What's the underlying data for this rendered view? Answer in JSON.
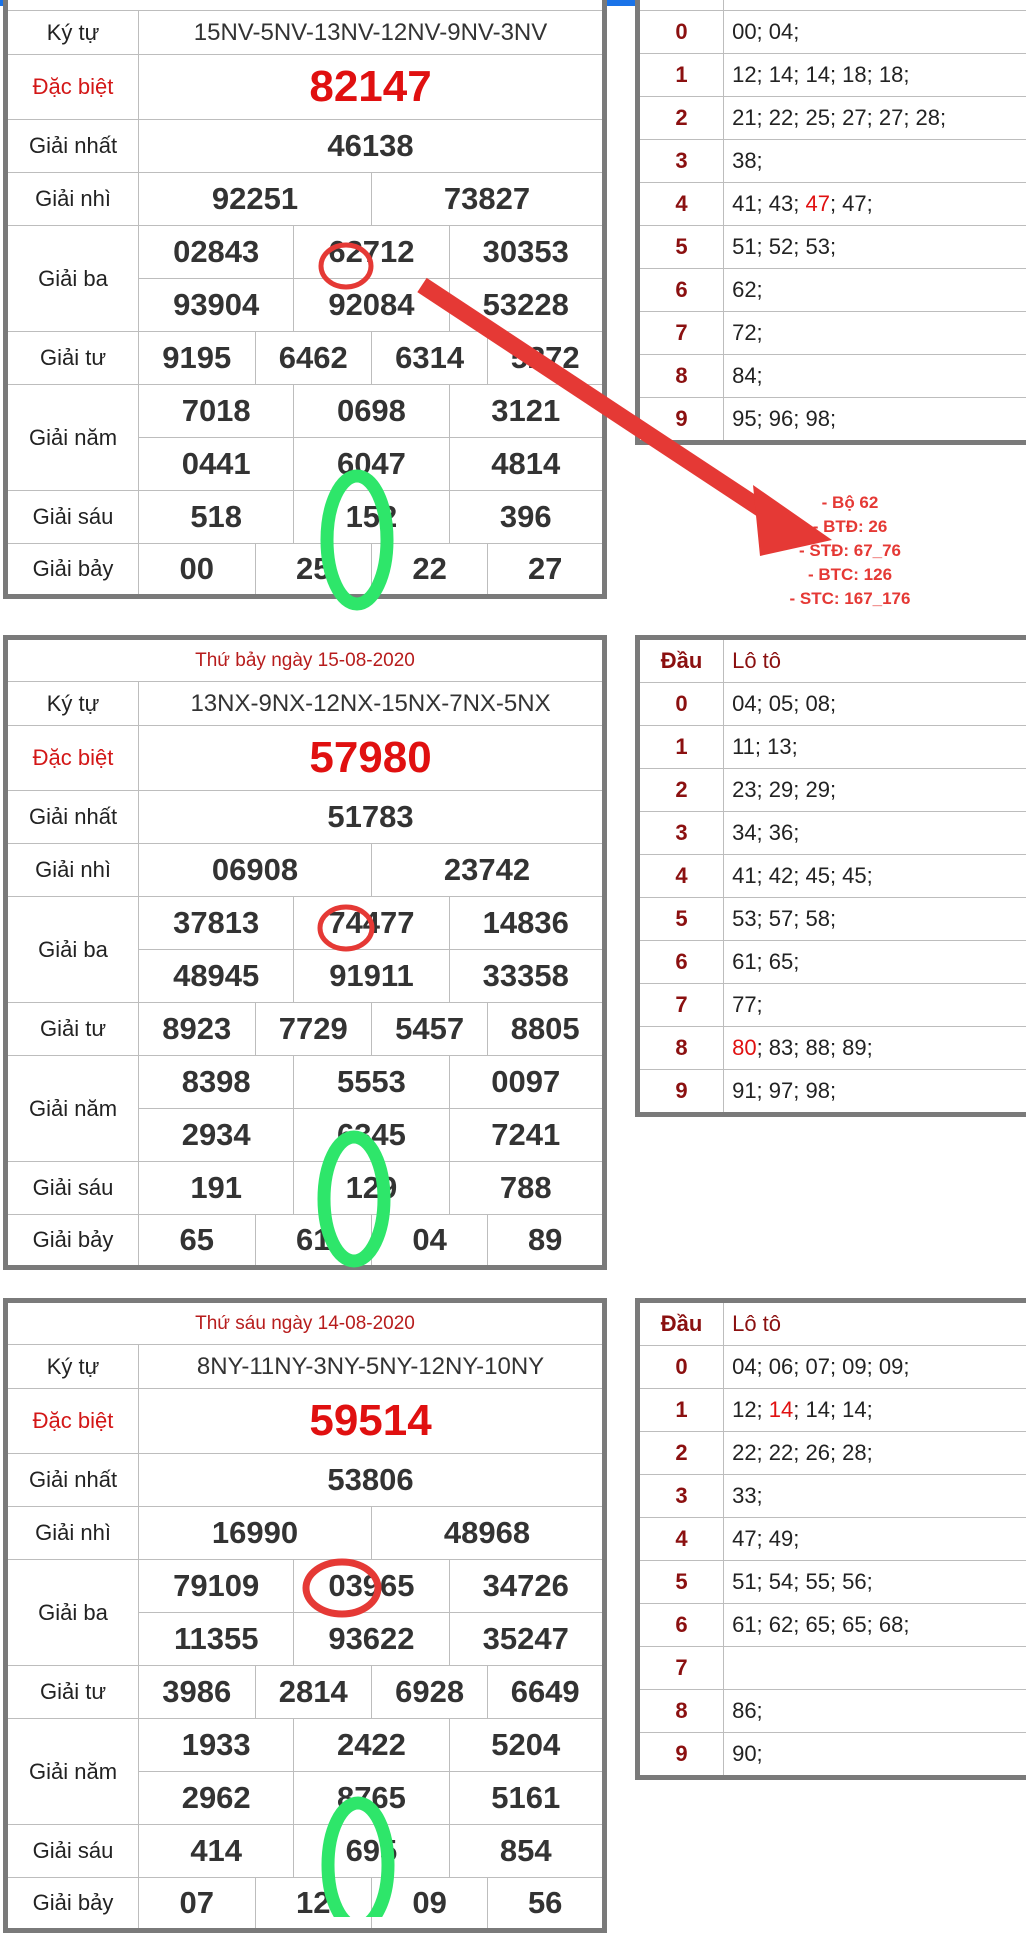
{
  "progress": {
    "fraction": 0.84
  },
  "colors": {
    "special": "#e01010",
    "highlight": "#e01010",
    "label_red": "#d31717",
    "circle_red": "#e53935",
    "circle_green": "#2ee66a",
    "frame": "#7a7a7a"
  },
  "labels": {
    "ky_tu": "Ký tự",
    "dac_biet": "Đặc biệt",
    "giai_nhat": "Giải nhất",
    "giai_nhi": "Giải nhì",
    "giai_ba": "Giải ba",
    "giai_tu": "Giải tư",
    "giai_nam": "Giải năm",
    "giai_sau": "Giải sáu",
    "giai_bay": "Giải bảy",
    "dau": "Đầu",
    "loto": "Lô tô"
  },
  "annotation": {
    "lines": [
      "- Bộ 62",
      "- BTĐ: 26",
      "- STĐ: 67_76",
      "- BTC: 126",
      "- STC: 167_176"
    ]
  },
  "draws": [
    {
      "date": "",
      "code": "15NV-5NV-13NV-12NV-9NV-3NV",
      "special": "82147",
      "first": "46138",
      "second": [
        "92251",
        "73827"
      ],
      "third": [
        [
          "02843",
          "62712",
          "30353"
        ],
        [
          "93904",
          "92084",
          "53228"
        ]
      ],
      "fourth": [
        "9195",
        "6462",
        "6314",
        "5272"
      ],
      "fifth": [
        [
          "7018",
          "0698",
          "3121"
        ],
        [
          "0441",
          "6047",
          "4814"
        ]
      ],
      "sixth": [
        "518",
        "152",
        "396"
      ],
      "seventh": [
        "00",
        "25",
        "22",
        "27"
      ],
      "loto": [
        {
          "d": "0",
          "v": [
            {
              "t": "00; 04;"
            }
          ]
        },
        {
          "d": "1",
          "v": [
            {
              "t": "12; 14; 14; 18; 18;"
            }
          ]
        },
        {
          "d": "2",
          "v": [
            {
              "t": "21; 22; 25; 27; 27; 28;"
            }
          ]
        },
        {
          "d": "3",
          "v": [
            {
              "t": "38;"
            }
          ]
        },
        {
          "d": "4",
          "v": [
            {
              "t": "41; 43; "
            },
            {
              "t": "47",
              "hl": true
            },
            {
              "t": "; 47;"
            }
          ]
        },
        {
          "d": "5",
          "v": [
            {
              "t": "51; 52; 53;"
            }
          ]
        },
        {
          "d": "6",
          "v": [
            {
              "t": "62;"
            }
          ]
        },
        {
          "d": "7",
          "v": [
            {
              "t": "72;"
            }
          ]
        },
        {
          "d": "8",
          "v": [
            {
              "t": "84;"
            }
          ]
        },
        {
          "d": "9",
          "v": [
            {
              "t": "95; 96; 98;"
            }
          ]
        }
      ]
    },
    {
      "date": "Thứ bảy ngày 15-08-2020",
      "code": "13NX-9NX-12NX-15NX-7NX-5NX",
      "special": "57980",
      "first": "51783",
      "second": [
        "06908",
        "23742"
      ],
      "third": [
        [
          "37813",
          "74477",
          "14836"
        ],
        [
          "48945",
          "91911",
          "33358"
        ]
      ],
      "fourth": [
        "8923",
        "7729",
        "5457",
        "8805"
      ],
      "fifth": [
        [
          "8398",
          "5553",
          "0097"
        ],
        [
          "2934",
          "6345",
          "7241"
        ]
      ],
      "sixth": [
        "191",
        "129",
        "788"
      ],
      "seventh": [
        "65",
        "61",
        "04",
        "89"
      ],
      "loto": [
        {
          "d": "0",
          "v": [
            {
              "t": "04; 05; 08;"
            }
          ]
        },
        {
          "d": "1",
          "v": [
            {
              "t": "11; 13;"
            }
          ]
        },
        {
          "d": "2",
          "v": [
            {
              "t": "23; 29; 29;"
            }
          ]
        },
        {
          "d": "3",
          "v": [
            {
              "t": "34; 36;"
            }
          ]
        },
        {
          "d": "4",
          "v": [
            {
              "t": "41; 42; 45; 45;"
            }
          ]
        },
        {
          "d": "5",
          "v": [
            {
              "t": "53; 57; 58;"
            }
          ]
        },
        {
          "d": "6",
          "v": [
            {
              "t": "61; 65;"
            }
          ]
        },
        {
          "d": "7",
          "v": [
            {
              "t": "77;"
            }
          ]
        },
        {
          "d": "8",
          "v": [
            {
              "t": "80",
              "hl": true
            },
            {
              "t": "; 83; 88; 89;"
            }
          ]
        },
        {
          "d": "9",
          "v": [
            {
              "t": "91; 97; 98;"
            }
          ]
        }
      ]
    },
    {
      "date": "Thứ sáu ngày 14-08-2020",
      "code": "8NY-11NY-3NY-5NY-12NY-10NY",
      "special": "59514",
      "first": "53806",
      "second": [
        "16990",
        "48968"
      ],
      "third": [
        [
          "79109",
          "03965",
          "34726"
        ],
        [
          "11355",
          "93622",
          "35247"
        ]
      ],
      "fourth": [
        "3986",
        "2814",
        "6928",
        "6649"
      ],
      "fifth": [
        [
          "1933",
          "2422",
          "5204"
        ],
        [
          "2962",
          "8765",
          "5161"
        ]
      ],
      "sixth": [
        "414",
        "695",
        "854"
      ],
      "seventh": [
        "07",
        "12",
        "09",
        "56"
      ],
      "loto": [
        {
          "d": "0",
          "v": [
            {
              "t": "04; 06; 07; 09; 09;"
            }
          ]
        },
        {
          "d": "1",
          "v": [
            {
              "t": "12; "
            },
            {
              "t": "14",
              "hl": true
            },
            {
              "t": "; 14; 14;"
            }
          ]
        },
        {
          "d": "2",
          "v": [
            {
              "t": "22; 22; 26; 28;"
            }
          ]
        },
        {
          "d": "3",
          "v": [
            {
              "t": "33;"
            }
          ]
        },
        {
          "d": "4",
          "v": [
            {
              "t": "47; 49;"
            }
          ]
        },
        {
          "d": "5",
          "v": [
            {
              "t": "51; 54; 55; 56;"
            }
          ]
        },
        {
          "d": "6",
          "v": [
            {
              "t": "61; 62; 65; 65; 68;"
            }
          ]
        },
        {
          "d": "7",
          "v": [
            {
              "t": ""
            }
          ]
        },
        {
          "d": "8",
          "v": [
            {
              "t": "86;"
            }
          ]
        },
        {
          "d": "9",
          "v": [
            {
              "t": "90;"
            }
          ]
        }
      ]
    }
  ]
}
